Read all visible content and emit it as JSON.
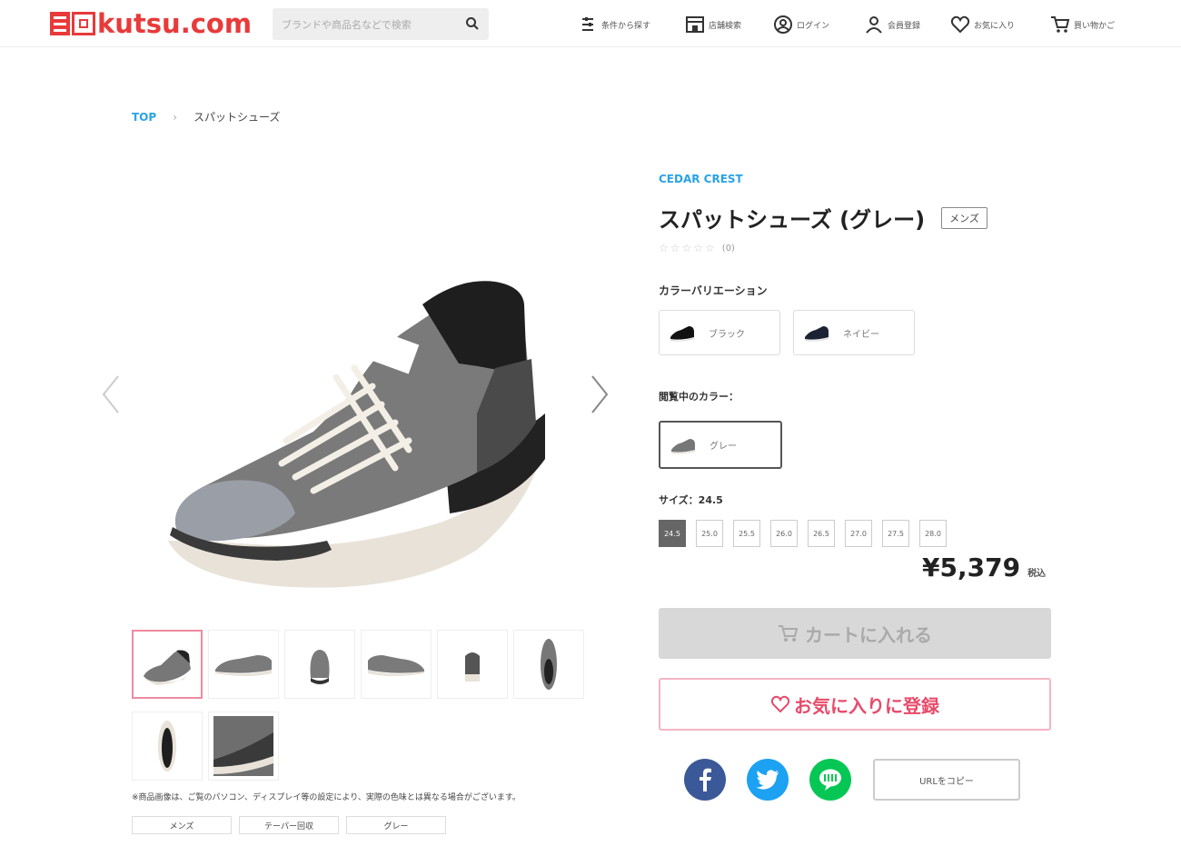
{
  "header": {
    "logo_text": "kutsu.com",
    "search_placeholder": "ブランドや商品名などで検索",
    "nav": [
      {
        "label": "条件から探す",
        "icon": "filter-icon"
      },
      {
        "label": "店舗検索",
        "icon": "store-icon"
      },
      {
        "label": "ログイン",
        "icon": "login-icon"
      },
      {
        "label": "会員登録",
        "icon": "user-icon"
      },
      {
        "label": "お気に入り",
        "icon": "heart-icon"
      },
      {
        "label": "買い物かご",
        "icon": "cart-icon"
      }
    ]
  },
  "breadcrumb": {
    "top": "TOP",
    "separator": "›",
    "current": "スパットシューズ"
  },
  "product": {
    "brand": "CEDAR CREST",
    "title": "スパットシューズ (グレー)",
    "gender": "メンズ",
    "rating_stars": "☆☆☆☆☆",
    "rating_count": "(0)",
    "color_variation_label": "カラーバリエーション",
    "color_variations": [
      "ブラック",
      "ネイビー"
    ],
    "selected_color_label": "閲覧中のカラー：",
    "selected_color": "グレー",
    "size_label": "サイズ：24.5",
    "sizes": [
      "24.5",
      "25.0",
      "25.5",
      "26.0",
      "26.5",
      "27.0",
      "27.5",
      "28.0"
    ],
    "selected_size": "24.5",
    "price": "¥5,379",
    "tax_label": "税込",
    "cart_button": "カートに入れる",
    "favorite_button": "お気に入りに登録",
    "url_copy_button": "URLをコピー"
  },
  "gallery": {
    "note": "※商品画像は、ご覧のパソコン、ディスプレイ等の設定により、実際の色味とは異なる場合がございます。",
    "tags": [
      "メンズ",
      "テーパー回収",
      "グレー"
    ]
  },
  "colors": {
    "accent_blue": "#2aa3e6",
    "brand_red": "#e83a3a",
    "favorite_pink": "#e84a6a",
    "facebook": "#3b5998",
    "twitter": "#1da1f2",
    "line": "#06c755"
  }
}
